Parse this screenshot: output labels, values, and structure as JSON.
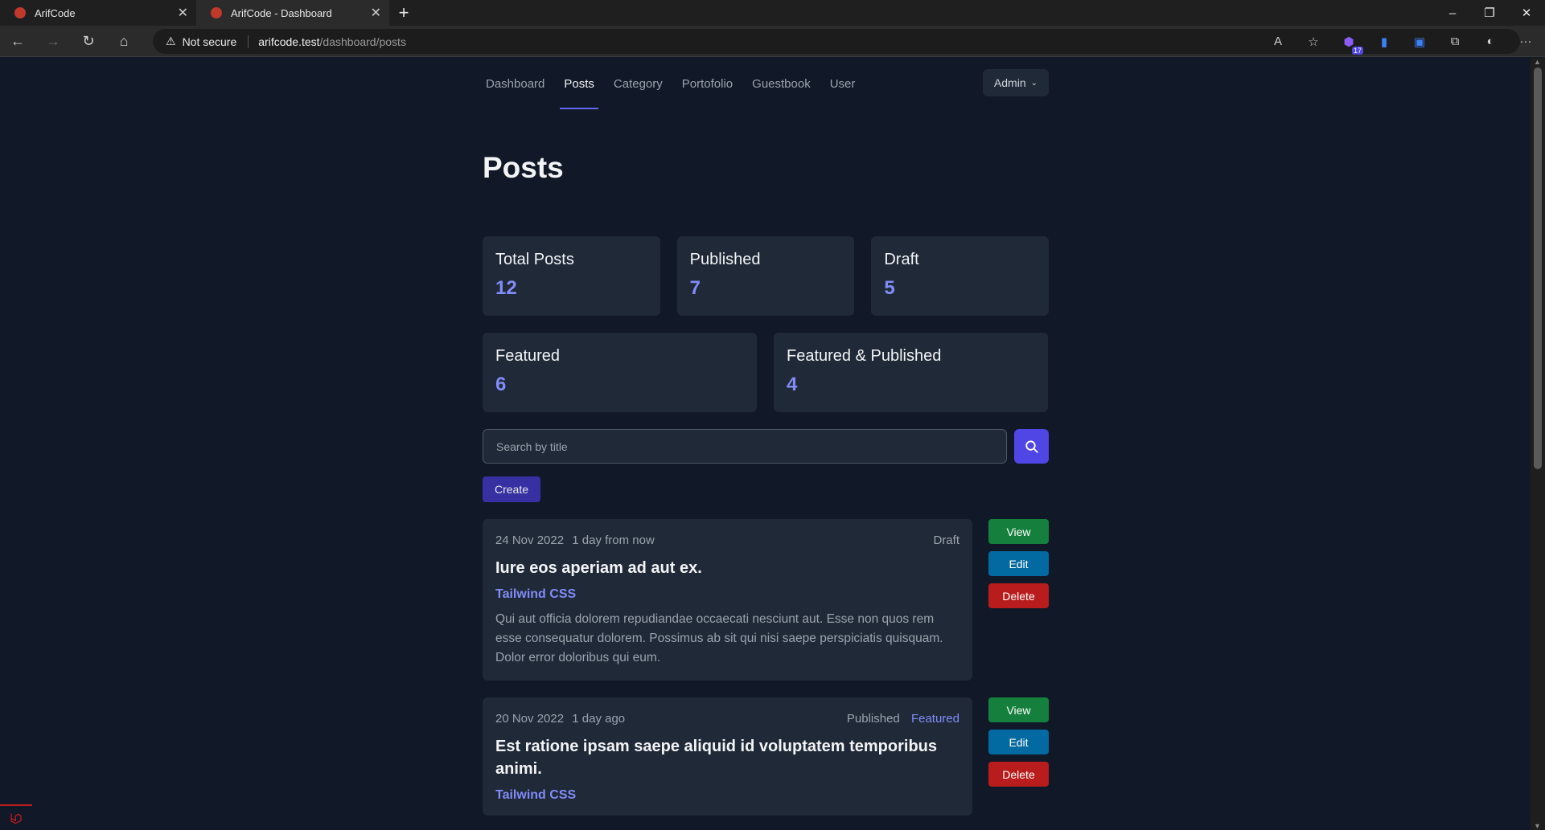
{
  "browser": {
    "tabs": [
      {
        "title": "ArifCode",
        "active": false
      },
      {
        "title": "ArifCode - Dashboard",
        "active": true
      }
    ],
    "address": {
      "security": "Not secure",
      "host": "arifcode.test",
      "path": "/dashboard/posts"
    },
    "extension_badge": "17"
  },
  "nav": {
    "items": [
      "Dashboard",
      "Posts",
      "Category",
      "Portofolio",
      "Guestbook",
      "User"
    ],
    "active": "Posts",
    "user_menu": "Admin"
  },
  "page": {
    "title": "Posts",
    "stats_row1": [
      {
        "label": "Total Posts",
        "value": "12"
      },
      {
        "label": "Published",
        "value": "7"
      },
      {
        "label": "Draft",
        "value": "5"
      }
    ],
    "stats_row2": [
      {
        "label": "Featured",
        "value": "6"
      },
      {
        "label": "Featured & Published",
        "value": "4"
      }
    ],
    "search": {
      "placeholder": "Search by title"
    },
    "create_label": "Create",
    "posts": [
      {
        "date": "24 Nov 2022",
        "relative": "1 day from now",
        "status": "Draft",
        "featured": "",
        "title": "Iure eos aperiam ad aut ex.",
        "category": "Tailwind CSS",
        "excerpt": "Qui aut officia dolorem repudiandae occaecati nesciunt aut. Esse non quos rem esse consequatur dolorem. Possimus ab sit qui nisi saepe perspiciatis quisquam. Dolor error doloribus qui eum."
      },
      {
        "date": "20 Nov 2022",
        "relative": "1 day ago",
        "status": "Published",
        "featured": "Featured",
        "title": "Est ratione ipsam saepe aliquid id voluptatem temporibus animi.",
        "category": "Tailwind CSS",
        "excerpt": ""
      }
    ],
    "actions": {
      "view": "View",
      "edit": "Edit",
      "delete": "Delete"
    }
  },
  "colors": {
    "accent": "#6366f1",
    "view": "#15803d",
    "edit": "#0369a1",
    "delete": "#b91c1c"
  }
}
